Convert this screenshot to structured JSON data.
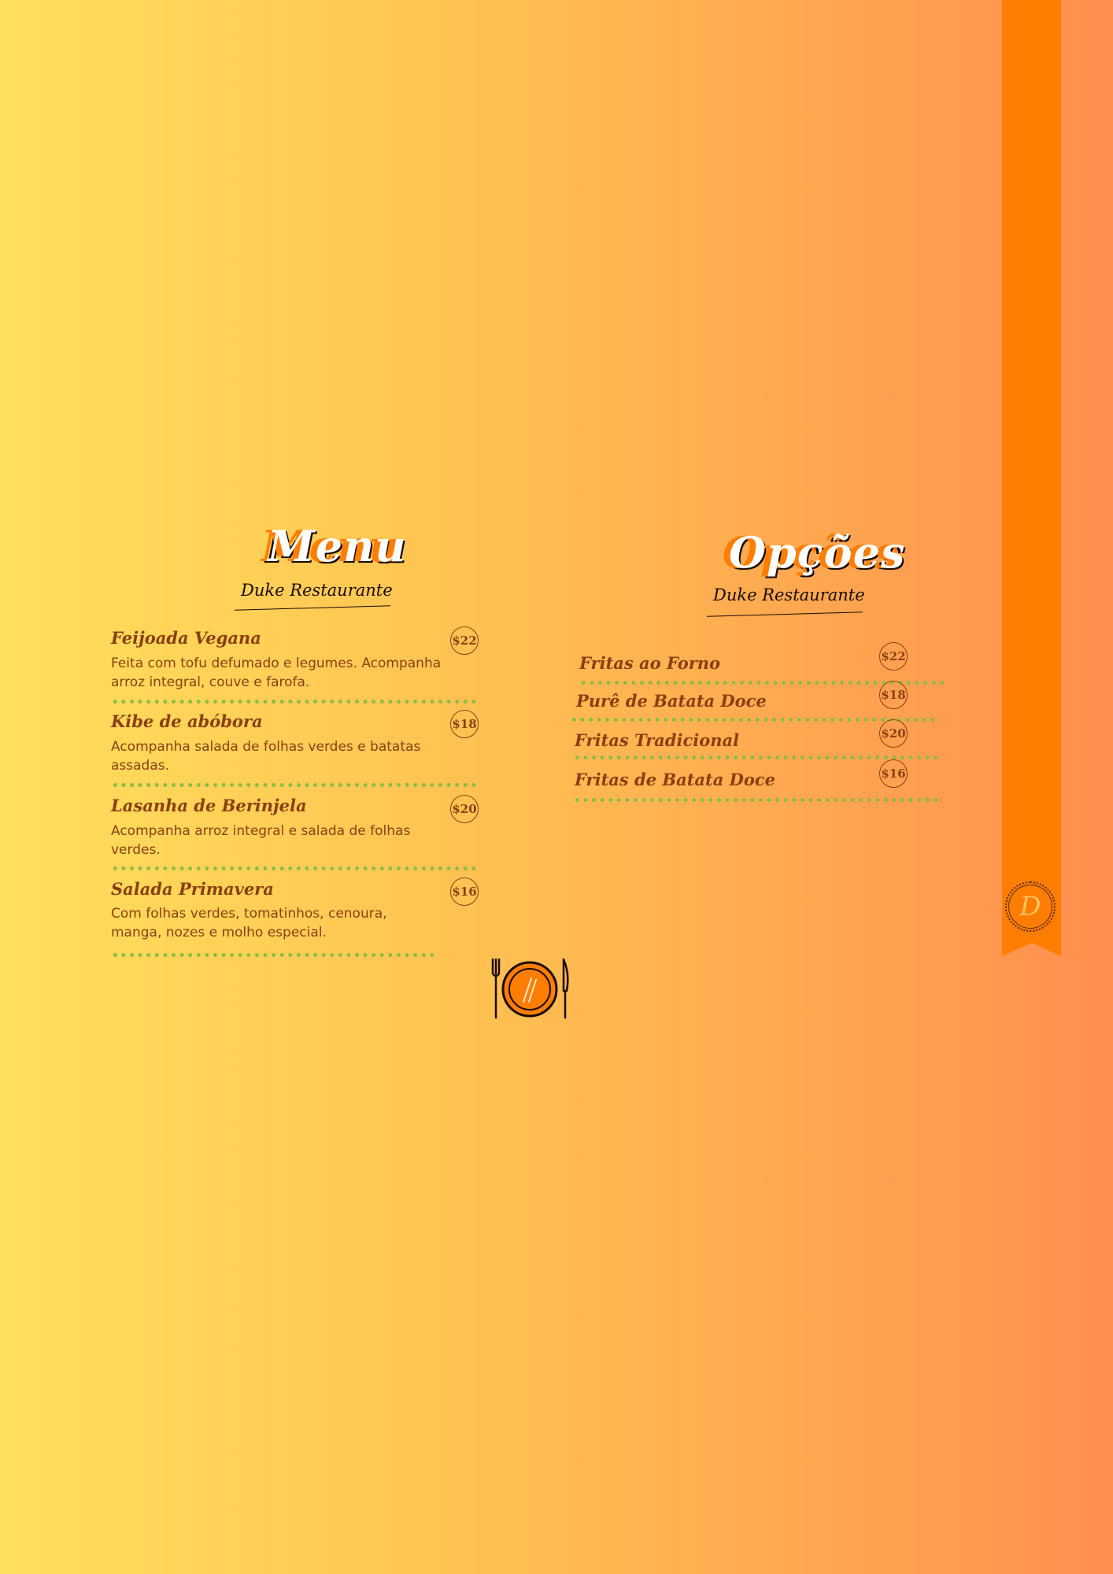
{
  "menu": {
    "title": "Menu",
    "subtitle": "Duke Restaurante",
    "items": [
      {
        "name": "Feijoada Vegana",
        "price": "$22",
        "description": "Feita com tofu defumado e legumes. Acompanha arroz integral, couve e farofa."
      },
      {
        "name": "Kibe de abóbora",
        "price": "$18",
        "description": "Acompanha salada de folhas verdes e batatas assadas."
      },
      {
        "name": "Lasanha de Berinjela",
        "price": "$20",
        "description": "Acompanha arroz integral e salada de folhas verdes."
      },
      {
        "name": "Salada Primavera",
        "price": "$16",
        "description": "Com folhas verdes, tomatinhos, cenoura, manga, nozes e molho especial."
      }
    ]
  },
  "options": {
    "title": "Opções",
    "subtitle": "Duke Restaurante",
    "items": [
      {
        "name": "Fritas ao Forno",
        "price": "$22"
      },
      {
        "name": "Purê de Batata Doce",
        "price": "$18"
      },
      {
        "name": "Fritas Tradicional",
        "price": "$20"
      },
      {
        "name": "Fritas de Batata Doce",
        "price": "$16"
      }
    ]
  },
  "ribbon": {
    "seal_letter": "D",
    "color": "#ff7d00"
  },
  "colors": {
    "text": "#8a3f12",
    "dots": "#8cbc45",
    "accent": "#ff7d00"
  },
  "icons": {
    "plate": "plate-fork-knife-icon",
    "seal": "d-monogram-icon"
  }
}
